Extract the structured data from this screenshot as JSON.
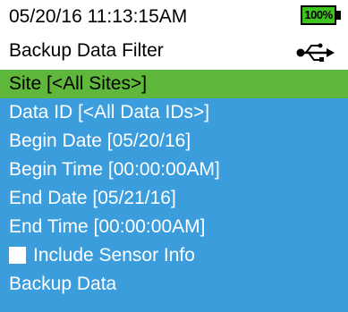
{
  "status": {
    "datetime": "05/20/16  11:13:15AM",
    "battery_label": "100%",
    "battery_level_percent": 100,
    "battery_color": "#3ec21e"
  },
  "header": {
    "title": "Backup Data Filter",
    "icon": "usb-icon"
  },
  "menu": {
    "background_color": "#3b9ddc",
    "selected_color": "#5fb83b",
    "items": [
      {
        "label": "Site [<All Sites>]",
        "selected": true
      },
      {
        "label": "Data ID [<All Data IDs>]",
        "selected": false
      },
      {
        "label": "Begin Date [05/20/16]",
        "selected": false
      },
      {
        "label": "Begin Time [00:00:00AM]",
        "selected": false
      },
      {
        "label": "End Date [05/21/16]",
        "selected": false
      },
      {
        "label": "End Time [00:00:00AM]",
        "selected": false
      },
      {
        "label": "Include Sensor Info",
        "selected": false,
        "checkbox": true,
        "checked": false
      },
      {
        "label": "Backup Data",
        "selected": false
      }
    ]
  }
}
